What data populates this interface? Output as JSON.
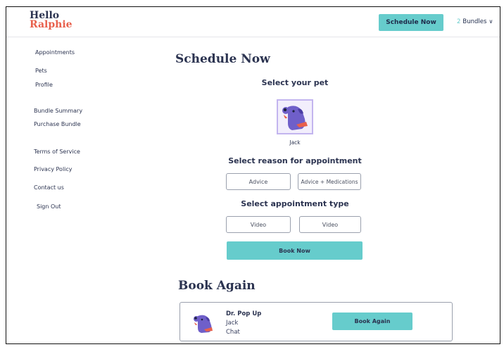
{
  "header": {
    "logo_line1": "Hello",
    "logo_line2": "Ralphie",
    "schedule_button": "Schedule Now",
    "bundles_count": "2",
    "bundles_label": "Bundles"
  },
  "sidebar": {
    "items": [
      {
        "label": "Appointments"
      },
      {
        "label": "Pets"
      },
      {
        "label": "Profile"
      },
      {
        "label": "Bundle Summary"
      },
      {
        "label": "Purchase Bundle"
      },
      {
        "label": "Terms of Service"
      },
      {
        "label": "Privacy Policy"
      },
      {
        "label": "Contact us"
      },
      {
        "label": "Sign Out"
      }
    ]
  },
  "main": {
    "title": "Schedule Now",
    "select_pet_heading": "Select your pet",
    "pet_name": "Jack",
    "reason_heading": "Select reason for appointment",
    "reason_options": [
      "Advice",
      "Advice + Medications"
    ],
    "type_heading": "Select appointment type",
    "type_options": [
      "Video",
      "Video"
    ],
    "book_now_label": "Book Now"
  },
  "book_again": {
    "title": "Book Again",
    "doctor": "Dr. Pop Up",
    "pet": "Jack",
    "type": "Chat",
    "button_label": "Book Again"
  },
  "colors": {
    "accent": "#66cccc",
    "navy": "#2b3350",
    "brand_red": "#e8604c",
    "pet_tile_border": "#c3b5ef"
  },
  "icons": [
    "dog-avatar-icon",
    "chevron-down-icon"
  ]
}
